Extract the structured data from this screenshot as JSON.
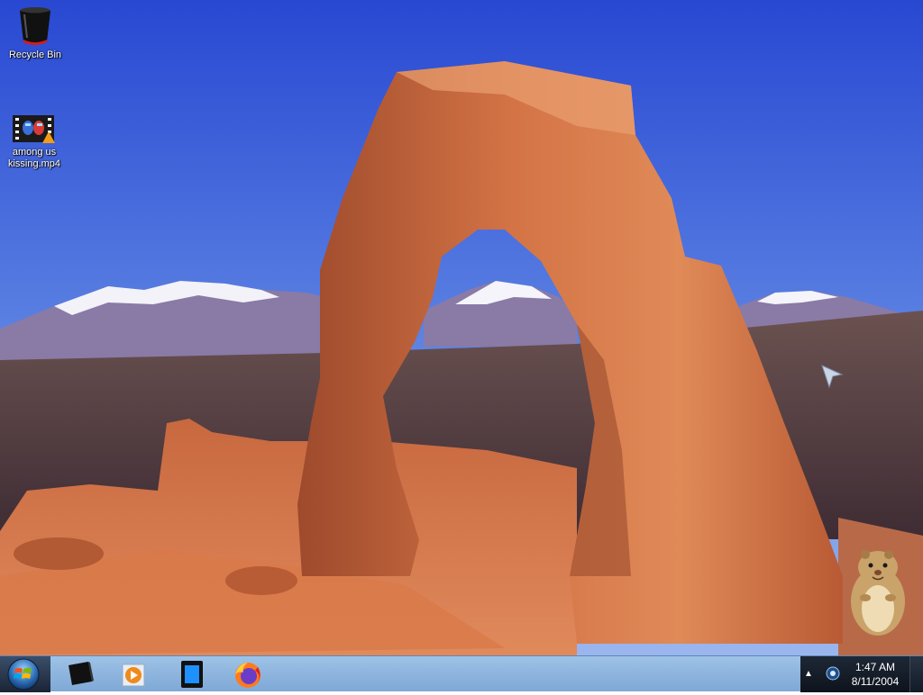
{
  "desktop": {
    "icons": [
      {
        "label": "Recycle Bin",
        "icon": "recycle-bin-icon"
      },
      {
        "label": "among us\nkissing.mp4",
        "label_line1": "among us",
        "label_line2": "kissing.mp4",
        "icon": "video-file-icon"
      }
    ],
    "wallpaper": "delicate-arch-wallpaper"
  },
  "taskbar": {
    "start": "windows-start-orb",
    "pinned": [
      {
        "name": "console-app",
        "icon": "terminal-icon"
      },
      {
        "name": "media-player",
        "icon": "media-player-icon"
      },
      {
        "name": "tablet-app",
        "icon": "tablet-icon"
      },
      {
        "name": "firefox",
        "icon": "firefox-icon"
      }
    ],
    "tray": {
      "time": "1:47 AM",
      "date": "8/11/2004",
      "overflow_glyph": "▲"
    }
  },
  "colors": {
    "sky_top": "#2b4fd6",
    "sky_bottom": "#7fa0e8",
    "rock": "#c5623a",
    "taskbar": "#8fb6df",
    "tray": "#0d131c"
  }
}
